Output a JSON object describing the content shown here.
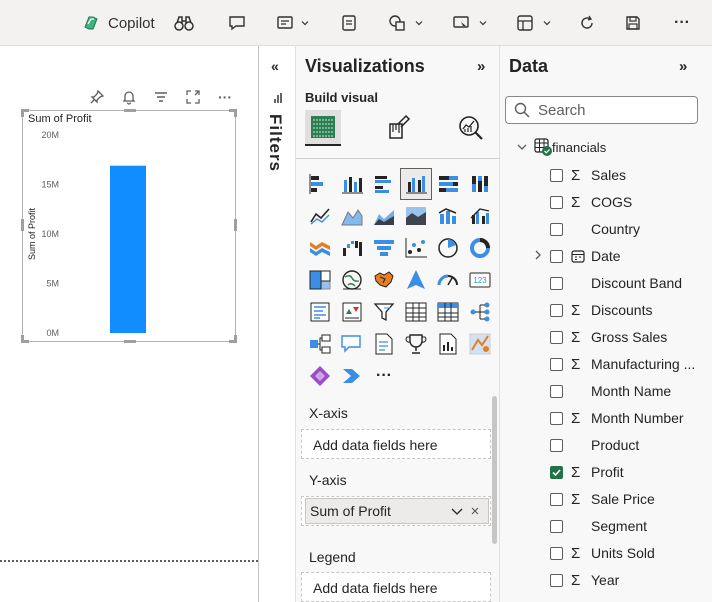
{
  "toolbar": {
    "copilot_label": "Copilot",
    "more_label": "···"
  },
  "canvas": {
    "visual": {
      "title": "Sum of Profit",
      "more_label": "···"
    }
  },
  "chart_data": {
    "type": "bar",
    "title": "Sum of Profit",
    "ylabel": "Sum of Profit",
    "xlabel": "",
    "categories": [
      ""
    ],
    "values": [
      16.9
    ],
    "ylim": [
      0,
      20
    ],
    "yticks": [
      "0M",
      "5M",
      "10M",
      "15M",
      "20M"
    ],
    "ytick_values": [
      0,
      5,
      10,
      15,
      20
    ],
    "bar_color": "#118DFF",
    "grid": false
  },
  "filters": {
    "collapse_label": "«",
    "title": "Filters"
  },
  "visualizations": {
    "title": "Visualizations",
    "expand_label": "»",
    "build_visual_label": "Build visual",
    "more_label": "···",
    "wells": {
      "xaxis_label": "X-axis",
      "xaxis_placeholder": "Add data fields here",
      "yaxis_label": "Y-axis",
      "yaxis_field": "Sum of Profit",
      "legend_label": "Legend",
      "legend_placeholder": "Add data fields here"
    }
  },
  "data_pane": {
    "title": "Data",
    "expand_label": "»",
    "search_placeholder": "Search",
    "table_name": "financials",
    "fields": [
      {
        "name": "Sales",
        "type": "sum",
        "checked": false,
        "expandable": false
      },
      {
        "name": "COGS",
        "type": "sum",
        "checked": false,
        "expandable": false
      },
      {
        "name": "Country",
        "type": "text",
        "checked": false,
        "expandable": false
      },
      {
        "name": "Date",
        "type": "date",
        "checked": false,
        "expandable": true
      },
      {
        "name": "Discount Band",
        "type": "text",
        "checked": false,
        "expandable": false
      },
      {
        "name": "Discounts",
        "type": "sum",
        "checked": false,
        "expandable": false
      },
      {
        "name": "Gross Sales",
        "type": "sum",
        "checked": false,
        "expandable": false
      },
      {
        "name": "Manufacturing ...",
        "type": "sum",
        "checked": false,
        "expandable": false
      },
      {
        "name": "Month Name",
        "type": "text",
        "checked": false,
        "expandable": false
      },
      {
        "name": "Month Number",
        "type": "sum",
        "checked": false,
        "expandable": false
      },
      {
        "name": "Product",
        "type": "text",
        "checked": false,
        "expandable": false
      },
      {
        "name": "Profit",
        "type": "sum",
        "checked": true,
        "expandable": false
      },
      {
        "name": "Sale Price",
        "type": "sum",
        "checked": false,
        "expandable": false
      },
      {
        "name": "Segment",
        "type": "text",
        "checked": false,
        "expandable": false
      },
      {
        "name": "Units Sold",
        "type": "sum",
        "checked": false,
        "expandable": false
      },
      {
        "name": "Year",
        "type": "sum",
        "checked": false,
        "expandable": false
      }
    ]
  },
  "colors": {
    "accent": "#118DFF",
    "checked": "#217346",
    "pane_bg": "#F8F8F8",
    "toolbar_bg": "#F3F2F1"
  }
}
